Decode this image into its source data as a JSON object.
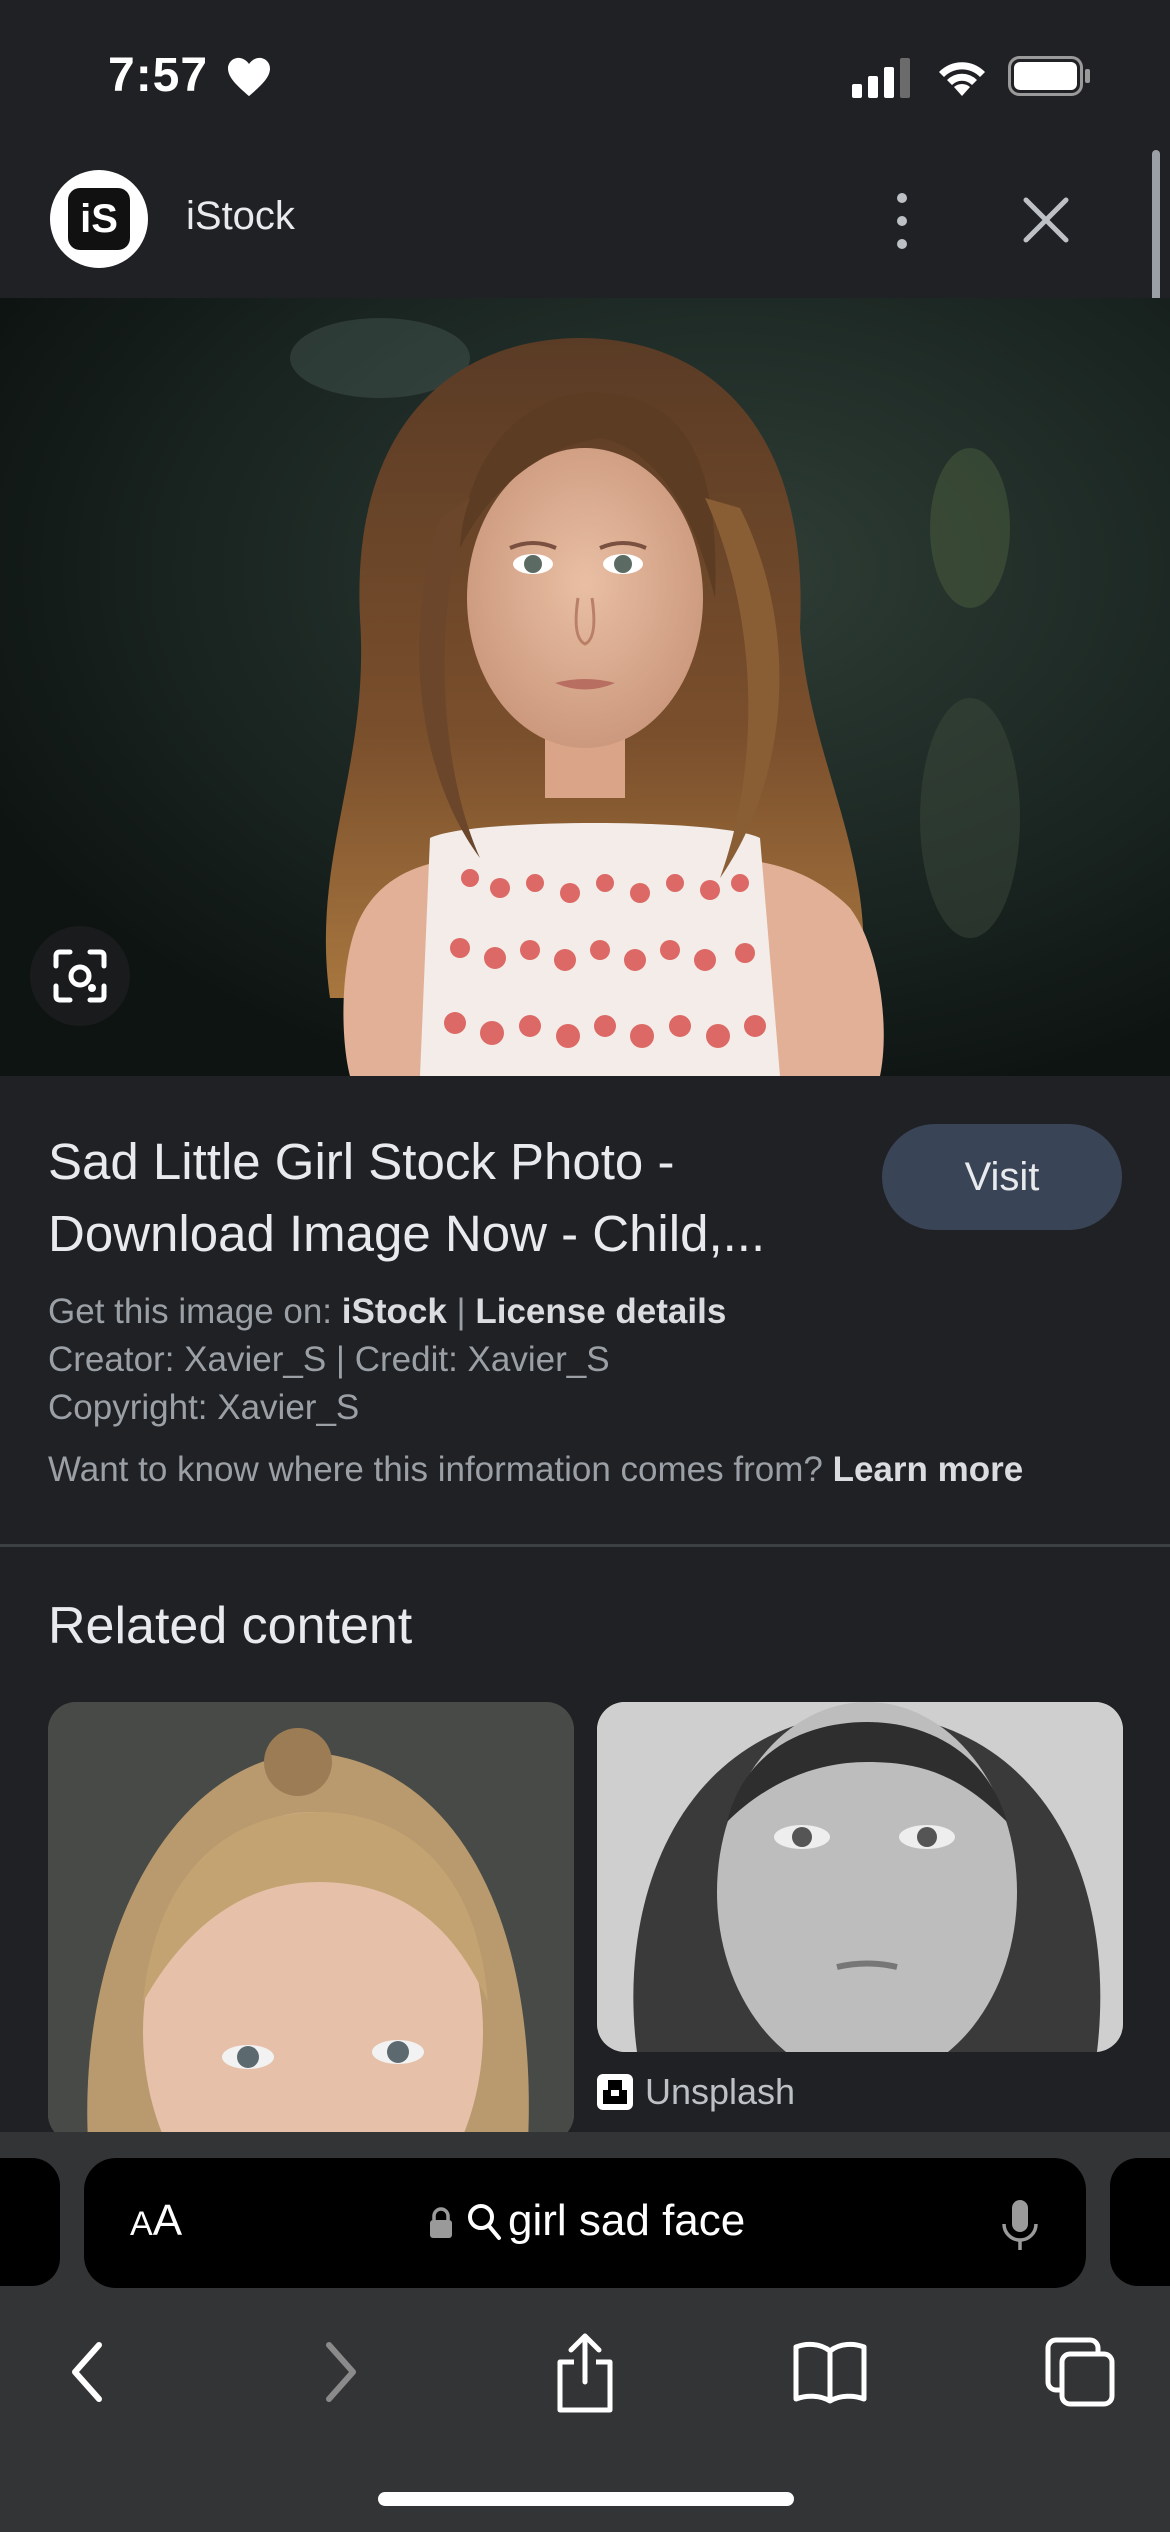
{
  "status_bar": {
    "time": "7:57"
  },
  "header": {
    "site_name": "iStock",
    "logo_text": "iS"
  },
  "result": {
    "title": "Sad Little Girl Stock Photo - Download Image Now - Child,...",
    "visit_label": "Visit",
    "get_image_prefix": "Get this image on: ",
    "get_image_site": "iStock",
    "separator": " | ",
    "license_details": "License details",
    "creator_line": "Creator: Xavier_S | Credit: Xavier_S",
    "copyright_line": "Copyright: Xavier_S",
    "info_question": "Want to know where this information comes from? ",
    "learn_more": "Learn more"
  },
  "related": {
    "heading": "Related content",
    "items": [
      {
        "source": ""
      },
      {
        "source": "Unsplash"
      }
    ]
  },
  "address_bar": {
    "aa_small": "A",
    "aa_large": "A",
    "query": "girl sad face"
  },
  "icons": {
    "heart": "heart-icon",
    "signal": "signal-icon",
    "wifi": "wifi-icon",
    "battery": "battery-icon",
    "more": "more-vert-icon",
    "close": "close-icon",
    "lens": "lens-icon",
    "lock": "lock-icon",
    "search": "search-icon",
    "mic": "mic-icon",
    "back": "chevron-left-icon",
    "forward": "chevron-right-icon",
    "share": "share-icon",
    "bookmarks": "book-icon",
    "tabs": "tabs-icon"
  },
  "colors": {
    "background": "#202124",
    "visit_button": "#394457",
    "toolbar": "#333436"
  }
}
